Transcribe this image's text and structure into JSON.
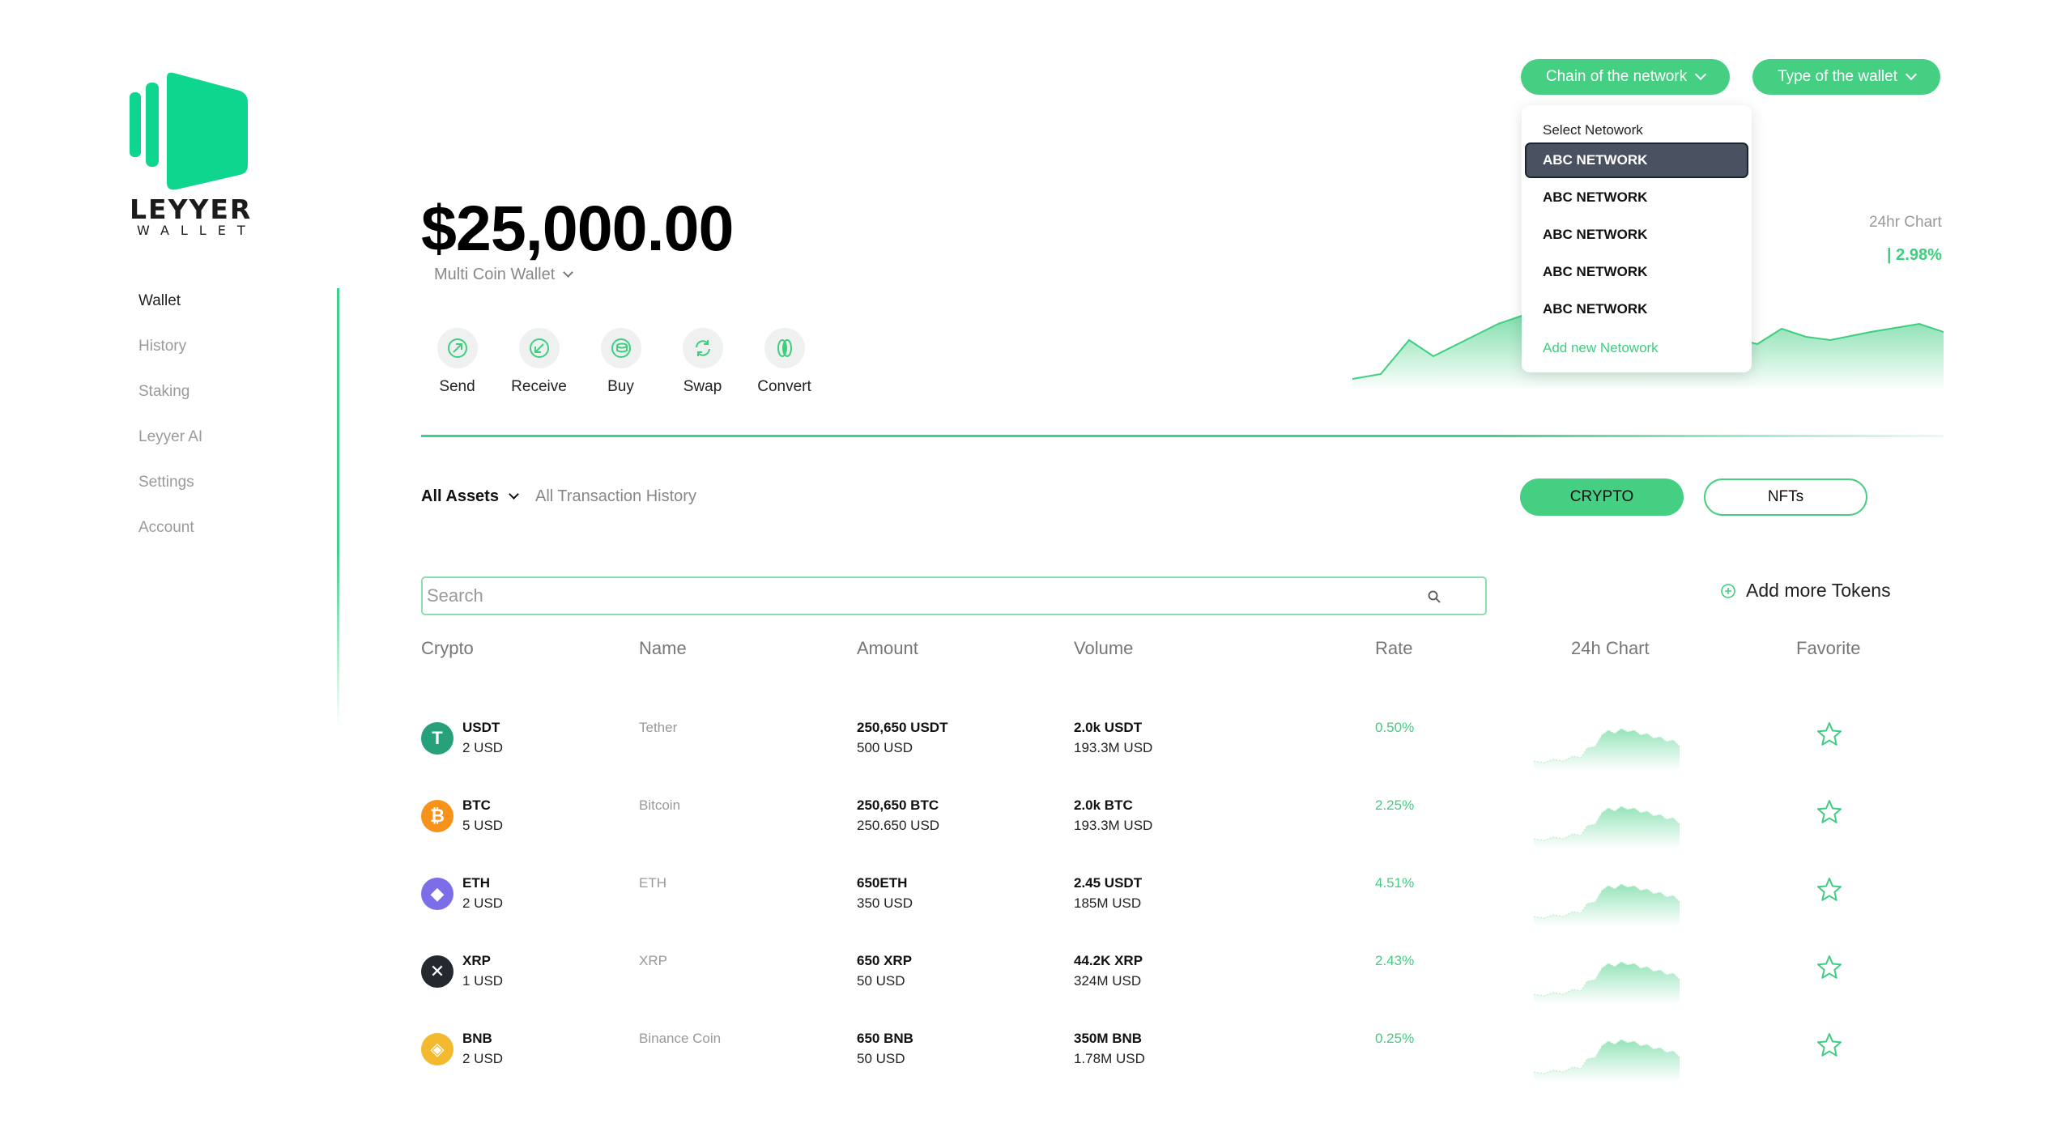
{
  "brand": {
    "name": "LEYYER",
    "sub": "WALLET",
    "color": "#0fd68f"
  },
  "sidebar": {
    "items": [
      {
        "label": "Wallet",
        "active": true
      },
      {
        "label": "History",
        "active": false
      },
      {
        "label": "Staking",
        "active": false
      },
      {
        "label": "Leyyer AI",
        "active": false
      },
      {
        "label": "Settings",
        "active": false
      },
      {
        "label": "Account",
        "active": false
      }
    ]
  },
  "header": {
    "chain_button": "Chain of the network",
    "type_button": "Type of the wallet"
  },
  "network_dropdown": {
    "title": "Select Netowork",
    "items": [
      "ABC NETWORK",
      "ABC NETWORK",
      "ABC NETWORK",
      "ABC NETWORK",
      "ABC NETWORK"
    ],
    "selected_index": 0,
    "add_label": "Add new Netowork"
  },
  "balance": {
    "amount": "$25,000.00",
    "wallet_type": "Multi Coin Wallet"
  },
  "actions": [
    {
      "label": "Send",
      "icon": "send-icon"
    },
    {
      "label": "Receive",
      "icon": "receive-icon"
    },
    {
      "label": "Buy",
      "icon": "buy-icon"
    },
    {
      "label": "Swap",
      "icon": "swap-icon"
    },
    {
      "label": "Convert",
      "icon": "convert-icon"
    }
  ],
  "overview_chart": {
    "label": "24hr Chart",
    "change": "| 2.98%"
  },
  "tabs": {
    "assets": "All Assets",
    "history": "All Transaction History"
  },
  "segment": {
    "crypto": "CRYPTO",
    "nfts": "NFTs",
    "active": "crypto"
  },
  "search": {
    "placeholder": "Search",
    "value": ""
  },
  "add_tokens": "Add more Tokens",
  "table": {
    "headers": [
      "Crypto",
      "Name",
      "Amount",
      "Volume",
      "Rate",
      "24h Chart",
      "Favorite"
    ],
    "rows": [
      {
        "symbol": "USDT",
        "price": "2 USD",
        "name": "Tether",
        "amount": "250,650 USDT",
        "amount_usd": "500 USD",
        "volume": "2.0k USDT",
        "volume_usd": "193.3M USD",
        "rate": "0.50%",
        "icon": "tether-icon",
        "color": "#26a17b",
        "glyph": "T"
      },
      {
        "symbol": "BTC",
        "price": "5 USD",
        "name": "Bitcoin",
        "amount": "250,650 BTC",
        "amount_usd": "250.650 USD",
        "volume": "2.0k BTC",
        "volume_usd": "193.3M USD",
        "rate": "2.25%",
        "icon": "bitcoin-icon",
        "color": "#f7931a",
        "glyph": "₿"
      },
      {
        "symbol": "ETH",
        "price": "2 USD",
        "name": "ETH",
        "amount": "650ETH",
        "amount_usd": "350 USD",
        "volume": "2.45 USDT",
        "volume_usd": "185M USD",
        "rate": "4.51%",
        "icon": "ethereum-icon",
        "color": "#7b6ee8",
        "glyph": "◆"
      },
      {
        "symbol": "XRP",
        "price": "1 USD",
        "name": "XRP",
        "amount": "650 XRP",
        "amount_usd": "50 USD",
        "volume": "44.2K XRP",
        "volume_usd": "324M USD",
        "rate": "2.43%",
        "icon": "xrp-icon",
        "color": "#23292f",
        "glyph": "✕"
      },
      {
        "symbol": "BNB",
        "price": "2 USD",
        "name": "Binance Coin",
        "amount": "650 BNB",
        "amount_usd": "50 USD",
        "volume": "350M BNB",
        "volume_usd": "1.78M USD",
        "rate": "0.25%",
        "icon": "bnb-icon",
        "color": "#f3ba2f",
        "glyph": "◈"
      }
    ]
  },
  "colors": {
    "accent": "#44cf82",
    "accent_text": "#3fce80",
    "selected_bg": "#4a5160"
  }
}
